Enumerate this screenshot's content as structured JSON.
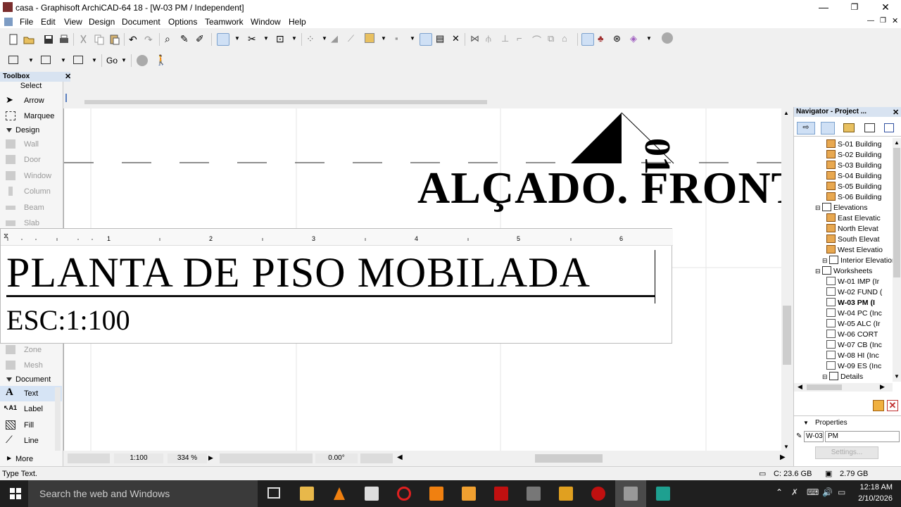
{
  "window": {
    "title": "casa - Graphisoft ArchiCAD-64 18 - [W-03 PM / Independent]",
    "minimize": "—",
    "restore": "❐",
    "close": "✕"
  },
  "menu": [
    "File",
    "Edit",
    "View",
    "Design",
    "Document",
    "Options",
    "Teamwork",
    "Window",
    "Help"
  ],
  "toolbar2": {
    "go_label": "Go"
  },
  "toolbox": {
    "title": "Toolbox",
    "select_label": "Select",
    "tools_select": [
      {
        "name": "arrow",
        "label": "Arrow",
        "icon": "arrow-icon"
      },
      {
        "name": "marquee",
        "label": "Marquee",
        "icon": "marquee-icon"
      }
    ],
    "design_group": "Design",
    "tools_design": [
      {
        "name": "wall",
        "label": "Wall",
        "icon": "wall-icon"
      },
      {
        "name": "door",
        "label": "Door",
        "icon": "door-icon"
      },
      {
        "name": "window",
        "label": "Window",
        "icon": "window-icon"
      },
      {
        "name": "column",
        "label": "Column",
        "icon": "column-icon"
      },
      {
        "name": "beam",
        "label": "Beam",
        "icon": "beam-icon"
      },
      {
        "name": "slab",
        "label": "Slab",
        "icon": "slab-icon"
      }
    ],
    "tools_design_lower": [
      {
        "name": "zone",
        "label": "Zone",
        "icon": "zone-icon"
      },
      {
        "name": "mesh",
        "label": "Mesh",
        "icon": "mesh-icon"
      }
    ],
    "document_group": "Document",
    "tools_document": [
      {
        "name": "text",
        "label": "Text",
        "icon": "text-icon"
      },
      {
        "name": "label",
        "label": "Label",
        "icon": "label-icon"
      },
      {
        "name": "fill",
        "label": "Fill",
        "icon": "fill-icon"
      },
      {
        "name": "line",
        "label": "Line",
        "icon": "line-icon"
      }
    ],
    "more_label": "More"
  },
  "canvas": {
    "elevation_title": "ALÇADO. FRONT",
    "elevation_number": "01",
    "plan_title": "PLANTA DE PISO MOBILADA",
    "plan_scale": "ESC:1:100",
    "ruler_marks": [
      "1",
      "2",
      "3",
      "4",
      "5",
      "6"
    ]
  },
  "canvas_status": {
    "scale": "1:100",
    "zoom": "334 %",
    "angle": "0.00°"
  },
  "navigator": {
    "title": "Navigator - Project ...",
    "items": [
      {
        "label": "S-01 Building",
        "kind": "house"
      },
      {
        "label": "S-02 Building",
        "kind": "house"
      },
      {
        "label": "S-03 Building",
        "kind": "house"
      },
      {
        "label": "S-04 Building",
        "kind": "house"
      },
      {
        "label": "S-05 Building",
        "kind": "house"
      },
      {
        "label": "S-06 Building",
        "kind": "house"
      },
      {
        "label": "Elevations",
        "kind": "folder"
      },
      {
        "label": "East Elevatic",
        "kind": "house"
      },
      {
        "label": "North Elevat",
        "kind": "house"
      },
      {
        "label": "South Elevat",
        "kind": "house"
      },
      {
        "label": "West Elevatio",
        "kind": "house"
      },
      {
        "label": "Interior Elevation",
        "kind": "folder"
      },
      {
        "label": "Worksheets",
        "kind": "folder"
      },
      {
        "label": "W-01 IMP (Ir",
        "kind": "sheet"
      },
      {
        "label": "W-02 FUND (",
        "kind": "sheet"
      },
      {
        "label": "W-03 PM (I",
        "kind": "sheet"
      },
      {
        "label": "W-04 PC (Inc",
        "kind": "sheet"
      },
      {
        "label": "W-05 ALC (Ir",
        "kind": "sheet"
      },
      {
        "label": "W-06 CORT",
        "kind": "sheet"
      },
      {
        "label": "W-07 CB (Inc",
        "kind": "sheet"
      },
      {
        "label": "W-08 HI (Inc",
        "kind": "sheet"
      },
      {
        "label": "W-09 ES (Inc",
        "kind": "sheet"
      },
      {
        "label": "Details",
        "kind": "folder"
      }
    ],
    "properties_label": "Properties",
    "prop_id": "W-03",
    "prop_name": "PM",
    "settings_label": "Settings..."
  },
  "statusbar": {
    "hint": "Type Text.",
    "disk": "C: 23.6 GB",
    "memory": "2.79 GB"
  },
  "taskbar": {
    "search_placeholder": "Search the web and Windows",
    "time": "12:18 AM",
    "date": "2/10/2026"
  },
  "colors": {
    "accent": "#cfe0f5",
    "title_red": "#7a2d2d",
    "taskbar": "#1f1f1f"
  }
}
